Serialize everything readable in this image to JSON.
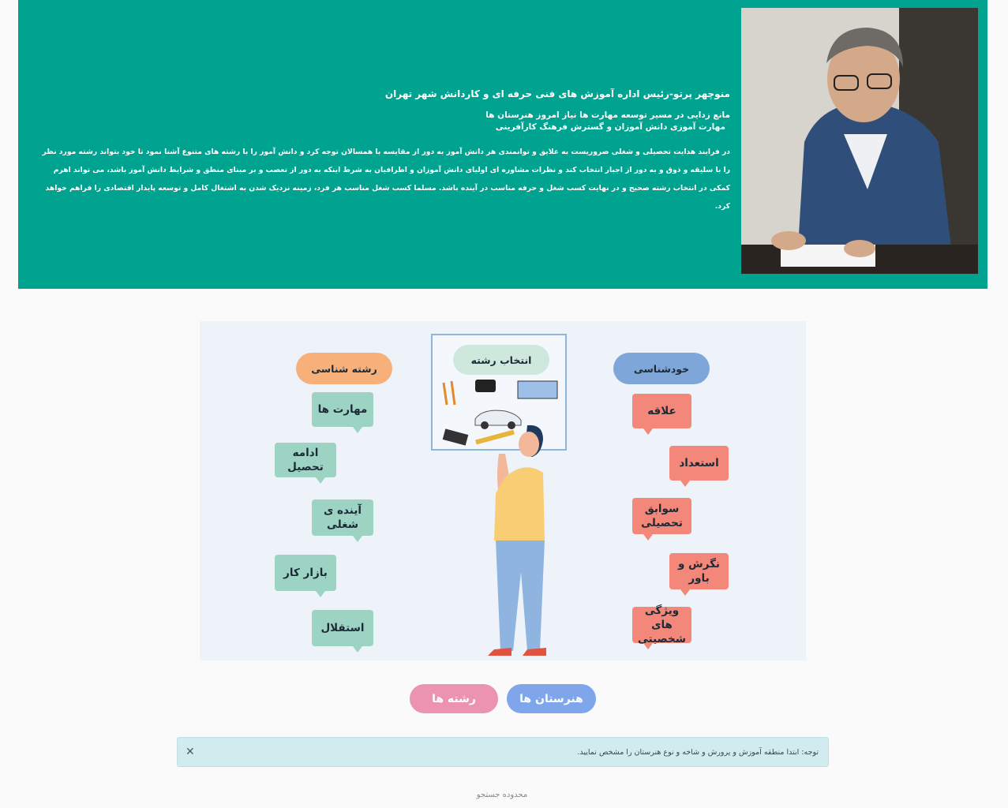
{
  "hero": {
    "title": "منوچهر پرتو-رئیس اداره آموزش های فنی حرفه ای و کاردانش شهر تهران",
    "subtitle_1": "مانع زدایی در مسیر توسعه مهارت ها نیاز امروز هنرستان ها",
    "subtitle_2": "مهارت آموزی دانش آموزان و گسترش فرهنگ کارآفرینی",
    "body": "در فرایند هدایت تحصیلی و شغلی ضروریست به علایق و توانمندی هر دانش آموز به دور از مقایسه با همسالان توجه کرد و دانش آموز را با رشته های متنوع آشنا نمود تا خود بتواند رشته مورد نظر را با سلیقه و ذوق و به دور از اجبار انتخاب کند و نظرات مشاوره ای اولیای دانش آموزان و اطرافیان به شرط اینکه به دور از تعصب و بر مبنای منطق و شرایط دانش آموز باشد، می تواند اهرم کمکی در انتخاب رشته صحیح و در نهایت کسب شغل و حرفه مناسب در آینده باشد. مسلما کسب شغل مناسب هر فرد، زمینه نزدیک شدن به اشتغال کامل و توسعه پایدار اقتصادی را فراهم خواهد کرد."
  },
  "illustration": {
    "board_label": "انتخاب رشته",
    "left_header": "رشته شناسی",
    "right_header": "خودشناسی",
    "left_items": [
      "مهارت ها",
      "ادامه تحصیل",
      "آینده ی شغلی",
      "بازار کار",
      "استقلال"
    ],
    "right_items": [
      "علاقه",
      "استعداد",
      "سوابق تحصیلی",
      "نگرش و باور",
      "ویژگی های شخصیتی"
    ]
  },
  "buttons": {
    "schools": "هنرستان ها",
    "fields": "رشته ها"
  },
  "alert": {
    "text": "توجه: ابتدا منطقه آموزش و پرورش و شاخه و نوع هنرستان را مشخص نمایید.",
    "close_icon": "close-icon"
  },
  "search": {
    "label": "محدوده جستجو"
  },
  "colors": {
    "hero_bg": "#00a390",
    "btn_schools": "#7fa6ea",
    "btn_fields": "#eb93b0",
    "alert_bg": "#d2ebef"
  }
}
